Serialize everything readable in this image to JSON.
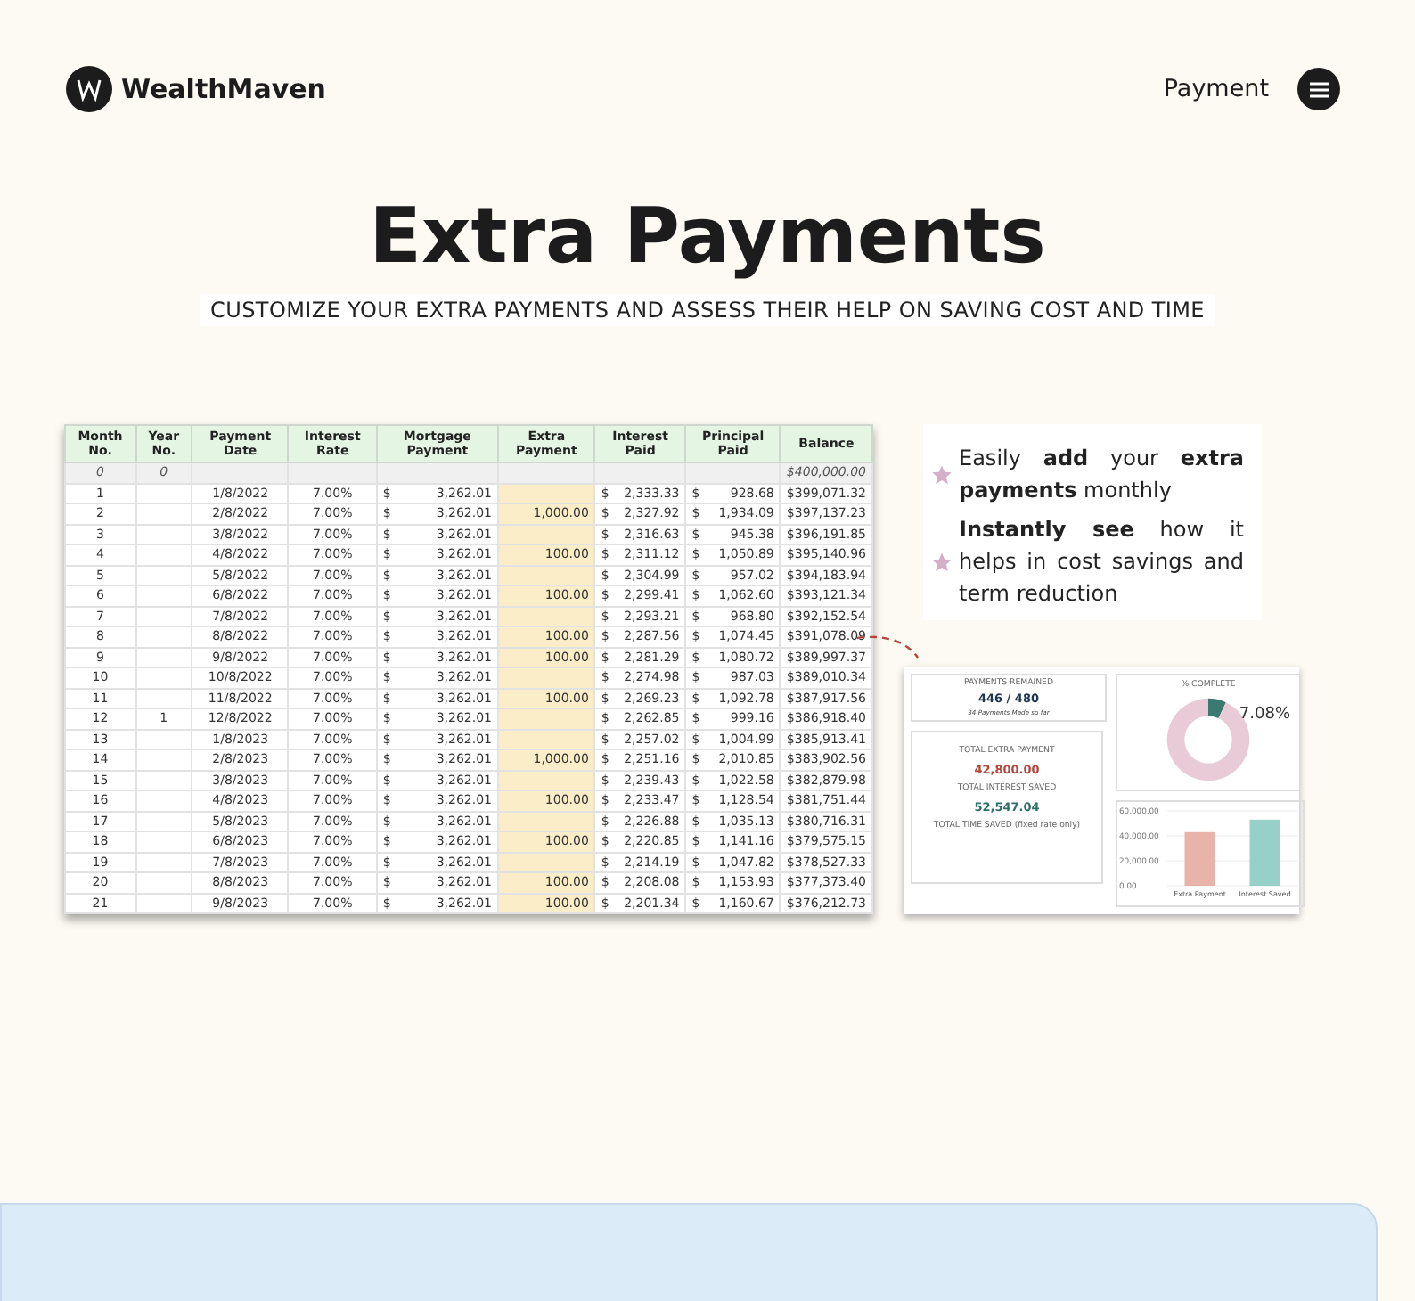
{
  "header": {
    "brand": "WealthMaven",
    "nav_link": "Payment"
  },
  "title": "Extra Payments",
  "subtitle": "CUSTOMIZE YOUR EXTRA PAYMENTS AND ASSESS THEIR HELP ON SAVING COST AND TIME",
  "table": {
    "columns": [
      "Month No.",
      "Year No.",
      "Payment Date",
      "Interest Rate",
      "Mortgage Payment",
      "Extra Payment",
      "Interest Paid",
      "Principal Paid",
      "Balance"
    ],
    "currency": "$",
    "start_row": {
      "month": "0",
      "year": "0",
      "balance": "400,000.00"
    },
    "rows": [
      {
        "month": "1",
        "year": "",
        "date": "1/8/2022",
        "rate": "7.00%",
        "mortgage": "3,262.01",
        "extra": "",
        "interest": "2,333.33",
        "principal": "928.68",
        "balance": "399,071.32"
      },
      {
        "month": "2",
        "year": "",
        "date": "2/8/2022",
        "rate": "7.00%",
        "mortgage": "3,262.01",
        "extra": "1,000.00",
        "interest": "2,327.92",
        "principal": "1,934.09",
        "balance": "397,137.23"
      },
      {
        "month": "3",
        "year": "",
        "date": "3/8/2022",
        "rate": "7.00%",
        "mortgage": "3,262.01",
        "extra": "",
        "interest": "2,316.63",
        "principal": "945.38",
        "balance": "396,191.85"
      },
      {
        "month": "4",
        "year": "",
        "date": "4/8/2022",
        "rate": "7.00%",
        "mortgage": "3,262.01",
        "extra": "100.00",
        "interest": "2,311.12",
        "principal": "1,050.89",
        "balance": "395,140.96"
      },
      {
        "month": "5",
        "year": "",
        "date": "5/8/2022",
        "rate": "7.00%",
        "mortgage": "3,262.01",
        "extra": "",
        "interest": "2,304.99",
        "principal": "957.02",
        "balance": "394,183.94"
      },
      {
        "month": "6",
        "year": "",
        "date": "6/8/2022",
        "rate": "7.00%",
        "mortgage": "3,262.01",
        "extra": "100.00",
        "interest": "2,299.41",
        "principal": "1,062.60",
        "balance": "393,121.34"
      },
      {
        "month": "7",
        "year": "",
        "date": "7/8/2022",
        "rate": "7.00%",
        "mortgage": "3,262.01",
        "extra": "",
        "interest": "2,293.21",
        "principal": "968.80",
        "balance": "392,152.54"
      },
      {
        "month": "8",
        "year": "",
        "date": "8/8/2022",
        "rate": "7.00%",
        "mortgage": "3,262.01",
        "extra": "100.00",
        "interest": "2,287.56",
        "principal": "1,074.45",
        "balance": "391,078.09"
      },
      {
        "month": "9",
        "year": "",
        "date": "9/8/2022",
        "rate": "7.00%",
        "mortgage": "3,262.01",
        "extra": "100.00",
        "interest": "2,281.29",
        "principal": "1,080.72",
        "balance": "389,997.37"
      },
      {
        "month": "10",
        "year": "",
        "date": "10/8/2022",
        "rate": "7.00%",
        "mortgage": "3,262.01",
        "extra": "",
        "interest": "2,274.98",
        "principal": "987.03",
        "balance": "389,010.34"
      },
      {
        "month": "11",
        "year": "",
        "date": "11/8/2022",
        "rate": "7.00%",
        "mortgage": "3,262.01",
        "extra": "100.00",
        "interest": "2,269.23",
        "principal": "1,092.78",
        "balance": "387,917.56"
      },
      {
        "month": "12",
        "year": "1",
        "date": "12/8/2022",
        "rate": "7.00%",
        "mortgage": "3,262.01",
        "extra": "",
        "interest": "2,262.85",
        "principal": "999.16",
        "balance": "386,918.40"
      },
      {
        "month": "13",
        "year": "",
        "date": "1/8/2023",
        "rate": "7.00%",
        "mortgage": "3,262.01",
        "extra": "",
        "interest": "2,257.02",
        "principal": "1,004.99",
        "balance": "385,913.41"
      },
      {
        "month": "14",
        "year": "",
        "date": "2/8/2023",
        "rate": "7.00%",
        "mortgage": "3,262.01",
        "extra": "1,000.00",
        "interest": "2,251.16",
        "principal": "2,010.85",
        "balance": "383,902.56"
      },
      {
        "month": "15",
        "year": "",
        "date": "3/8/2023",
        "rate": "7.00%",
        "mortgage": "3,262.01",
        "extra": "",
        "interest": "2,239.43",
        "principal": "1,022.58",
        "balance": "382,879.98"
      },
      {
        "month": "16",
        "year": "",
        "date": "4/8/2023",
        "rate": "7.00%",
        "mortgage": "3,262.01",
        "extra": "100.00",
        "interest": "2,233.47",
        "principal": "1,128.54",
        "balance": "381,751.44"
      },
      {
        "month": "17",
        "year": "",
        "date": "5/8/2023",
        "rate": "7.00%",
        "mortgage": "3,262.01",
        "extra": "",
        "interest": "2,226.88",
        "principal": "1,035.13",
        "balance": "380,716.31"
      },
      {
        "month": "18",
        "year": "",
        "date": "6/8/2023",
        "rate": "7.00%",
        "mortgage": "3,262.01",
        "extra": "100.00",
        "interest": "2,220.85",
        "principal": "1,141.16",
        "balance": "379,575.15"
      },
      {
        "month": "19",
        "year": "",
        "date": "7/8/2023",
        "rate": "7.00%",
        "mortgage": "3,262.01",
        "extra": "",
        "interest": "2,214.19",
        "principal": "1,047.82",
        "balance": "378,527.33"
      },
      {
        "month": "20",
        "year": "",
        "date": "8/8/2023",
        "rate": "7.00%",
        "mortgage": "3,262.01",
        "extra": "100.00",
        "interest": "2,208.08",
        "principal": "1,153.93",
        "balance": "377,373.40"
      },
      {
        "month": "21",
        "year": "",
        "date": "9/8/2023",
        "rate": "7.00%",
        "mortgage": "3,262.01",
        "extra": "100.00",
        "interest": "2,201.34",
        "principal": "1,160.67",
        "balance": "376,212.73"
      }
    ]
  },
  "features": [
    "Easily **add** your **extra payments** monthly",
    "**Instantly see** how it helps in cost savings and term reduction"
  ],
  "dashboard": {
    "remained": {
      "label": "PAYMENTS REMAINED",
      "value": "446 / 480",
      "note": "34 Payments Made so far"
    },
    "totals": [
      {
        "label": "TOTAL EXTRA PAYMENT",
        "value": "42,800.00",
        "kind": "extra"
      },
      {
        "label": "TOTAL INTEREST SAVED",
        "value": "52,547.04",
        "kind": "saved"
      }
    ],
    "time_saved": "TOTAL TIME SAVED (fixed rate only)",
    "complete": {
      "label": "% COMPLETE",
      "value": "7.08%",
      "chart_data": {
        "type": "donut",
        "values": [
          7.08,
          92.92
        ]
      }
    },
    "chart_data": {
      "type": "bar",
      "series": [
        {
          "name": "Extra Payment",
          "color": "#e8b4aa",
          "values": [
            43000
          ]
        },
        {
          "name": "Interest Saved",
          "color": "#97d0c8",
          "values": [
            53000
          ]
        }
      ],
      "ylim": [
        0,
        60000
      ],
      "yticks": [
        {
          "value": 0,
          "label": "0.00"
        },
        {
          "value": 20000,
          "label": "20,000.00"
        },
        {
          "value": 40000,
          "label": "40,000.00"
        },
        {
          "value": 60000,
          "label": "60,000.00"
        }
      ]
    }
  }
}
